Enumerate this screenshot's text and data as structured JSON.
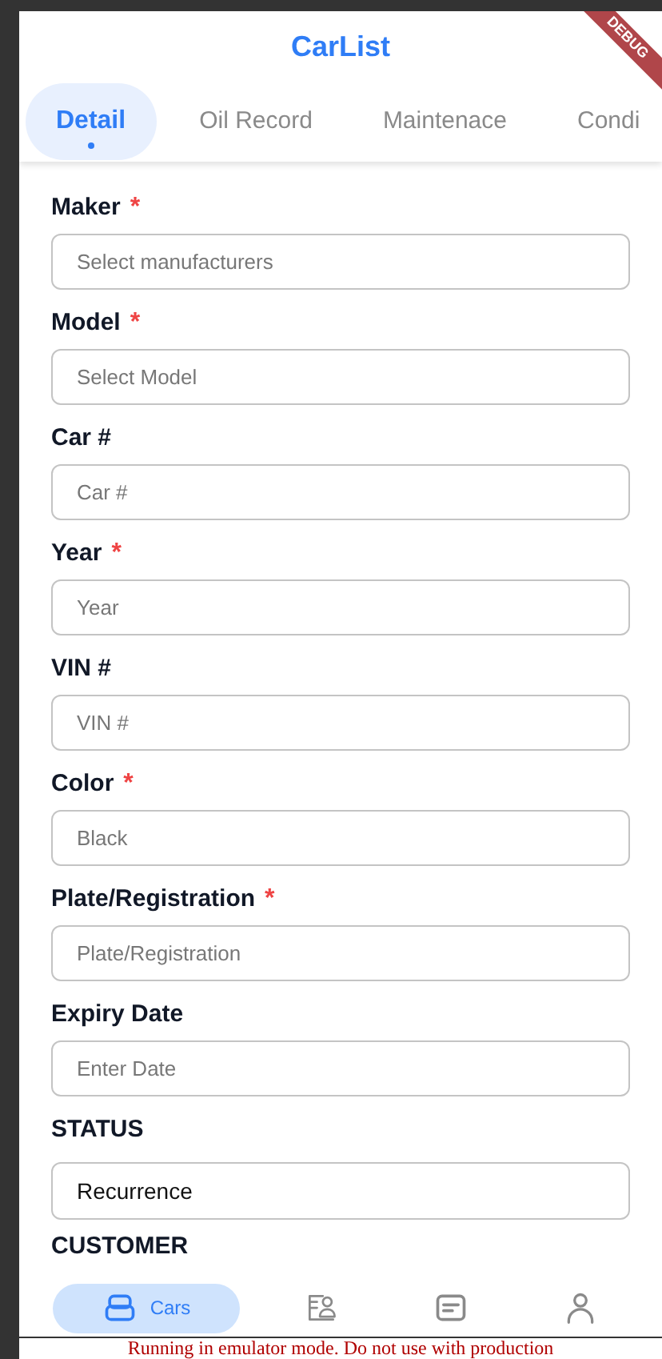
{
  "app_bar": {
    "title": "CarList",
    "debug_banner": "DEBUG"
  },
  "tabs": [
    {
      "label": "Detail",
      "selected": true
    },
    {
      "label": "Oil Record",
      "selected": false
    },
    {
      "label": "Maintenace",
      "selected": false
    },
    {
      "label": "Condi",
      "selected": false
    }
  ],
  "form": [
    {
      "label": "Maker",
      "required": true,
      "placeholder": "Select manufacturers"
    },
    {
      "label": "Model",
      "required": true,
      "placeholder": "Select Model"
    },
    {
      "label": "Car #",
      "required": false,
      "placeholder": "Car #"
    },
    {
      "label": "Year",
      "required": true,
      "placeholder": "Year"
    },
    {
      "label": "VIN #",
      "required": false,
      "placeholder": "VIN #"
    },
    {
      "label": "Color",
      "required": true,
      "placeholder": "Black"
    },
    {
      "label": "Plate/Registration",
      "required": true,
      "placeholder": "Plate/Registration"
    },
    {
      "label": "Expiry Date",
      "required": false,
      "placeholder": "Enter Date"
    },
    {
      "label": "STATUS",
      "required": false,
      "value": "Recurrence"
    },
    {
      "label": "CUSTOMER",
      "required": false
    }
  ],
  "required_mark": "*",
  "bottom_nav": [
    {
      "kind": "car",
      "label": "Cars",
      "selected": true
    },
    {
      "kind": "record",
      "selected": false
    },
    {
      "kind": "note",
      "selected": false
    },
    {
      "kind": "person",
      "selected": false
    }
  ],
  "emulator_notice": "Running in emulator mode. Do not use with production"
}
